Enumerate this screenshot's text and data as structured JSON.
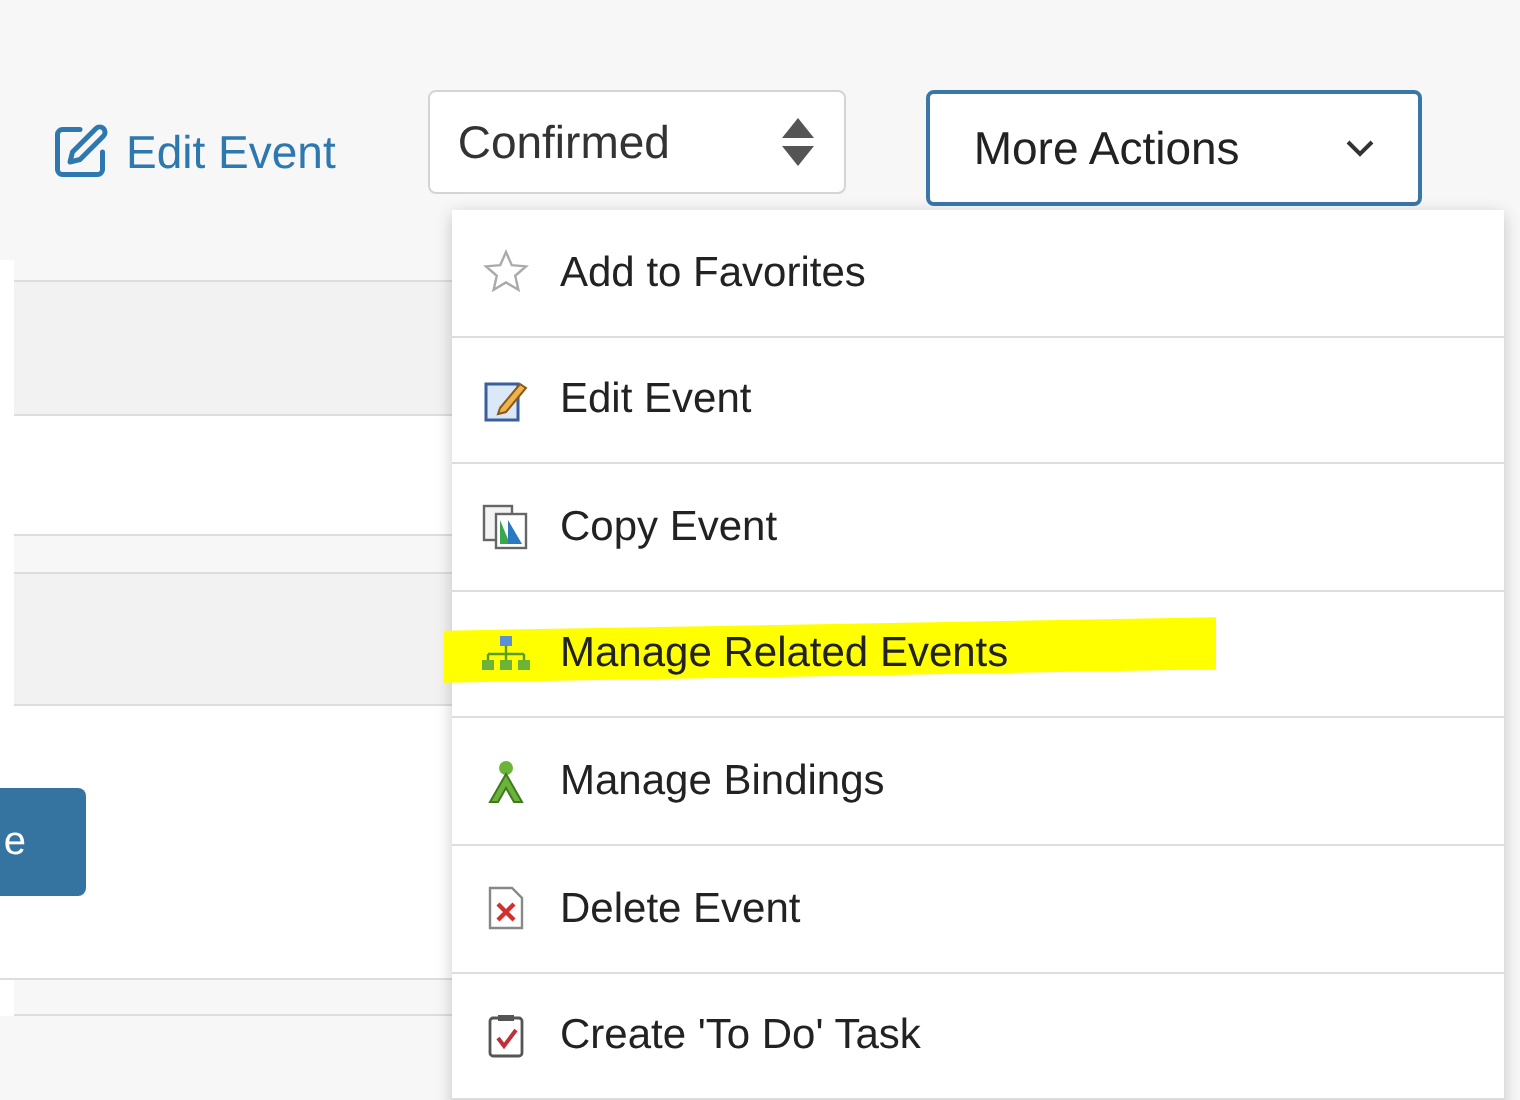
{
  "toolbar": {
    "edit_link": "Edit Event",
    "status_select": {
      "value": "Confirmed"
    },
    "more_actions": {
      "label": "More Actions",
      "expanded": true
    }
  },
  "background_button": {
    "label": "e"
  },
  "menu": [
    {
      "kind": "star",
      "label": "Add to Favorites",
      "highlighted": false
    },
    {
      "kind": "edit",
      "label": "Edit Event",
      "highlighted": false
    },
    {
      "kind": "copy",
      "label": "Copy Event",
      "highlighted": false
    },
    {
      "kind": "tree",
      "label": "Manage Related Events",
      "highlighted": true
    },
    {
      "kind": "binding",
      "label": "Manage Bindings",
      "highlighted": false
    },
    {
      "kind": "delete",
      "label": "Delete Event",
      "highlighted": false
    },
    {
      "kind": "todo",
      "label": "Create 'To Do' Task",
      "highlighted": false
    }
  ]
}
